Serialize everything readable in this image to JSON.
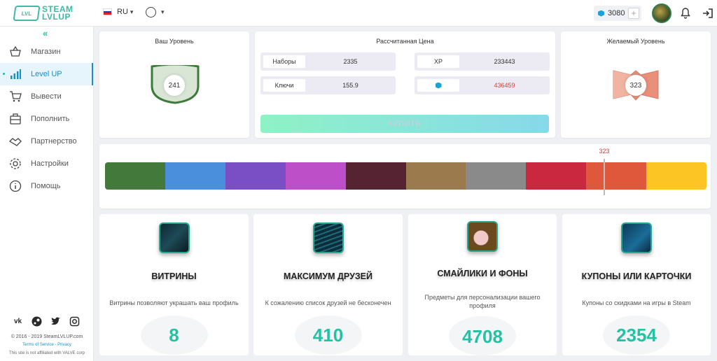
{
  "brand": {
    "line1": "STEAM",
    "line2": "LVLUP",
    "mark": "LVL"
  },
  "topbar": {
    "language": "RU",
    "balance": "3080",
    "plus": "+"
  },
  "sidebar": {
    "collapse": "«",
    "items": [
      {
        "label": "Магазин",
        "icon": "shop-basket-icon"
      },
      {
        "label": "Level UP",
        "icon": "bar-chart-icon"
      },
      {
        "label": "Вывести",
        "icon": "cart-withdraw-icon"
      },
      {
        "label": "Пополнить",
        "icon": "wallet-icon"
      },
      {
        "label": "Партнерство",
        "icon": "handshake-icon"
      },
      {
        "label": "Настройки",
        "icon": "gear-icon"
      },
      {
        "label": "Помощь",
        "icon": "info-icon"
      }
    ],
    "socials": [
      "vk-icon",
      "steam-icon",
      "twitter-icon",
      "instagram-icon"
    ],
    "copyright": "© 2016 - 2019 SteamLVLUP.com",
    "terms": "Terms of Service - Privacy",
    "disclaimer": "This site is not affiliated with VALVE corp"
  },
  "current_level": {
    "title": "Ваш Уровень",
    "value": "241",
    "color": "#3e7a3a"
  },
  "price": {
    "title": "Рассчитанная Цена",
    "sets_label": "Наборы",
    "sets_value": "2335",
    "xp_label": "XP",
    "xp_value": "233443",
    "keys_label": "Ключи",
    "keys_value": "155.9",
    "gems_value": "436459",
    "buy_label": "КУПИТЬ"
  },
  "desired_level": {
    "title": "Желаемый Уровень",
    "value": "323",
    "color": "#e8907a"
  },
  "level_scale": {
    "marker_value": "323",
    "marker_fraction": 0.83,
    "colors": [
      "#437a3c",
      "#4a8fdc",
      "#7a4ec4",
      "#bd4fc9",
      "#562333",
      "#9b7a4d",
      "#8a8a8a",
      "#c9283e",
      "#e0583c",
      "#fcc524"
    ]
  },
  "cards": [
    {
      "title": "ВИТРИНЫ",
      "desc": "Витрины позволяют украшать ваш профиль",
      "value": "8"
    },
    {
      "title": "МАКСИМУМ ДРУЗЕЙ",
      "desc": "К сожалению список друзей не бесконечен",
      "value": "410"
    },
    {
      "title": "СМАЙЛИКИ И ФОНЫ",
      "desc": "Предметы для персонализации вашего профиля",
      "value": "4708"
    },
    {
      "title": "КУПОНЫ ИЛИ КАРТОЧКИ",
      "desc": "Купоны со скидками на игры в Steam",
      "value": "2354"
    }
  ]
}
